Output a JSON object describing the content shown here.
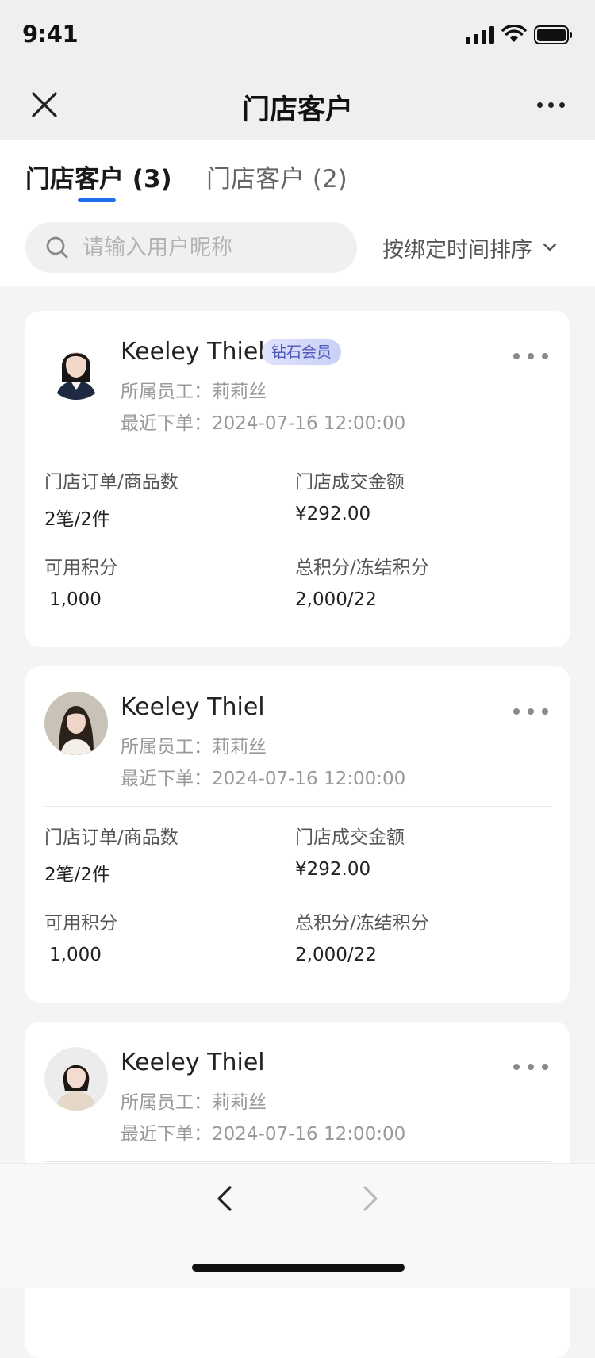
{
  "status_bar": {
    "time": "9:41"
  },
  "nav": {
    "title": "门店客户"
  },
  "tabs": [
    {
      "label": "门店客户 (3)",
      "active": true
    },
    {
      "label": "门店客户 (2)",
      "active": false
    }
  ],
  "search": {
    "placeholder": "请输入用户昵称",
    "value": ""
  },
  "sort": {
    "label": "按绑定时间排序"
  },
  "colors": {
    "accent": "#1f6fe8",
    "badge_text": "#4a56b8",
    "page_bg": "#f4f4f6"
  },
  "customers": [
    {
      "name": "Keeley Thiel",
      "badge": "钻石会员",
      "staff": "所属员工：莉莉丝",
      "recent_order": "最近下单：2024-07-16 12:00:00",
      "order_label": "门店订单/商品数",
      "order_value": "2笔/2件",
      "amount_label": "门店成交金额",
      "amount_value": "¥292.00",
      "points_label": "可用积分",
      "points_value": "1,000",
      "total_label": "总积分/冻结积分",
      "total_value": "2,000/22"
    },
    {
      "name": "Keeley Thiel",
      "badge": "",
      "staff": "所属员工：莉莉丝",
      "recent_order": "最近下单：2024-07-16 12:00:00",
      "order_label": "门店订单/商品数",
      "order_value": "2笔/2件",
      "amount_label": "门店成交金额",
      "amount_value": "¥292.00",
      "points_label": "可用积分",
      "points_value": "1,000",
      "total_label": "总积分/冻结积分",
      "total_value": "2,000/22"
    },
    {
      "name": "Keeley Thiel",
      "badge": "",
      "staff": "所属员工：莉莉丝",
      "recent_order": "最近下单：2024-07-16 12:00:00"
    }
  ]
}
